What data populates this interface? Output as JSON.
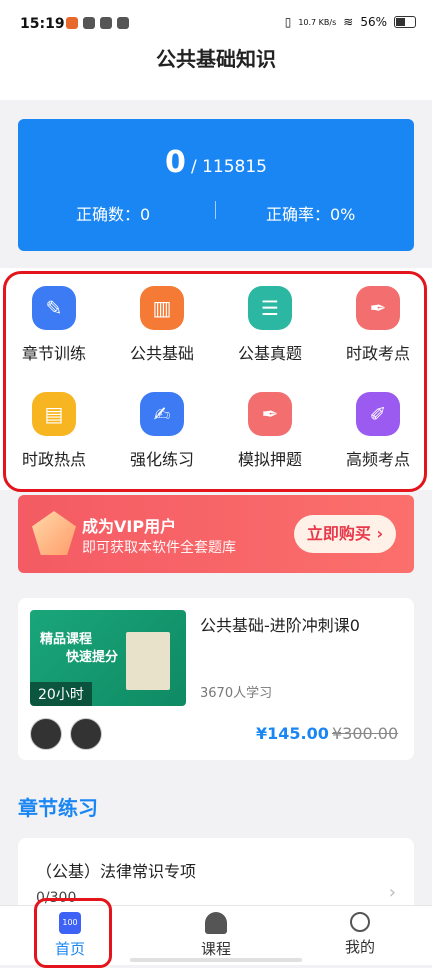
{
  "status_bar": {
    "time": "15:19",
    "net_speed": "10.7 KB/s",
    "battery": "56%"
  },
  "header": {
    "title": "公共基础知识"
  },
  "score": {
    "correct": "0",
    "total": "/ 115815",
    "correct_count_label": "正确数：0",
    "accuracy_label": "正确率：0%"
  },
  "grid": {
    "items": [
      {
        "label": "章节训练",
        "icon": "pencil-icon",
        "color": "#3d7bf5"
      },
      {
        "label": "公共基础",
        "icon": "book-icon",
        "color": "#f47a35"
      },
      {
        "label": "公基真题",
        "icon": "document-icon",
        "color": "#2cb7a3"
      },
      {
        "label": "时政考点",
        "icon": "pen-icon",
        "color": "#f36e6e"
      },
      {
        "label": "时政热点",
        "icon": "notepad-icon",
        "color": "#f7b521"
      },
      {
        "label": "强化练习",
        "icon": "edit-icon",
        "color": "#3d7bf5"
      },
      {
        "label": "模拟押题",
        "icon": "pen-icon",
        "color": "#f36e6e"
      },
      {
        "label": "高频考点",
        "icon": "brush-icon",
        "color": "#9b5af0"
      }
    ]
  },
  "vip": {
    "title": "成为VIP用户",
    "subtitle": "即可获取本软件全套题库",
    "button": "立即购买 ›"
  },
  "course": {
    "thumb_tag1": "精品课程",
    "thumb_tag2": "快速提分",
    "hours": "20小时",
    "title": "公共基础-进阶冲刺课0",
    "learners": "3670人学习",
    "price": "¥145.00",
    "original_price": "¥300.00"
  },
  "chapter_section": {
    "title": "章节练习",
    "item_title": "（公基）法律常识专项",
    "item_progress": "0/300",
    "chevron": "›"
  },
  "tabs": [
    {
      "label": "首页",
      "icon": "home-icon",
      "active": true
    },
    {
      "label": "课程",
      "icon": "course-icon",
      "active": false
    },
    {
      "label": "我的",
      "icon": "user-icon",
      "active": false
    }
  ],
  "colors": {
    "accent": "#1a86f4",
    "highlight_outline": "#e3141b",
    "vip": "#f45b64"
  }
}
